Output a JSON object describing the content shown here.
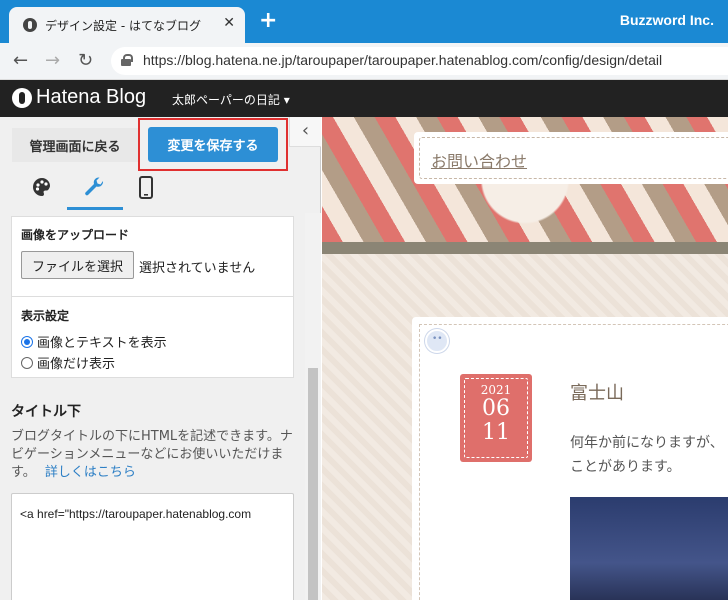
{
  "browser": {
    "tab_title": "デザイン設定 - はてなブログ",
    "tab_close": "✕",
    "new_tab": "+",
    "window_brand": "Buzzword Inc.",
    "url": "https://blog.hatena.ne.jp/taroupaper/taroupaper.hatenablog.com/config/design/detail",
    "nav": {
      "back": "←",
      "forward": "→",
      "reload": "↻"
    }
  },
  "header": {
    "brand": "Hatena Blog",
    "blog_name": "太郎ペーパーの日記 ▾"
  },
  "panel": {
    "back_label": "管理画面に戻る",
    "save_label": "変更を保存する",
    "collapse": "‹",
    "tabs": [
      {
        "name": "palette",
        "icon": "🎨"
      },
      {
        "name": "customize",
        "icon": "🔧"
      },
      {
        "name": "smartphone",
        "icon": "📱"
      }
    ],
    "upload_label": "画像をアップロード",
    "file_button": "ファイルを選択",
    "file_status": "選択されていません",
    "display_label": "表示設定",
    "radio_options": [
      "画像とテキストを表示",
      "画像だけ表示"
    ],
    "selected_index": 0,
    "section_title": "タイトル下",
    "description": "ブログタイトルの下にHTMLを記述できます。ナビゲーションメニューなどにお使いいただけます。",
    "details_link": "詳しくはこちら",
    "code_value": "<a href=\"https://taroupaper.hatenablog.com"
  },
  "preview": {
    "contact": "お問い合わせ",
    "date_year": "2021",
    "date_month": "06",
    "date_day": "11",
    "article_title": "富士山",
    "article_body_1": "何年か前になりますが、",
    "article_body_2": "ことがあります。"
  },
  "colors": {
    "titlebar": "#1b89d3",
    "save_button": "#2d8fd5",
    "highlight": "#e03030",
    "date_badge": "#df6f6b"
  }
}
